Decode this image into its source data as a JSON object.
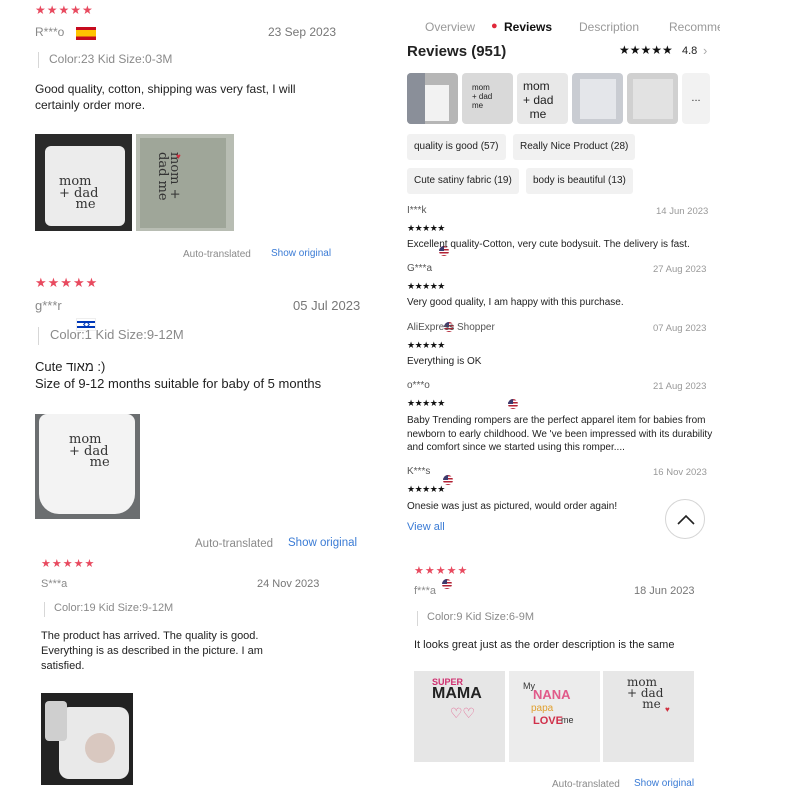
{
  "reviews_left": [
    {
      "stars": "★★★★★",
      "name": "R***o",
      "date": "23 Sep 2023",
      "variant": "Color:23 Kid Size:0-3M",
      "text": "Good quality, cotton, shipping was very fast, I will certainly order more.",
      "auto_translated": "Auto-translated",
      "show_original": "Show original"
    },
    {
      "stars": "★★★★★",
      "name": "g***r",
      "date": "05 Jul 2023",
      "variant": "Color:1 Kid Size:9-12M",
      "text_line1": "Cute מאוד :)",
      "text_line2": "Size of 9-12 months suitable for baby of 5 months",
      "auto_translated": "Auto-translated",
      "show_original": "Show original"
    },
    {
      "stars": "★★★★★",
      "name": "S***a",
      "date": "24 Nov 2023",
      "variant": "Color:19 Kid Size:9-12M",
      "text": "The product has arrived.  The quality is good.  Everything is as described in the picture.  I am satisfied."
    }
  ],
  "shirt_print": {
    "mom": "mom",
    "dad": "+ dad",
    "me": "me",
    "super": "SUPER",
    "mama": "MAMA",
    "my": "My",
    "nana": "NANA",
    "papa": "papa",
    "love": "LOVE",
    "me2": "me"
  },
  "product_panel": {
    "tabs": [
      "Overview",
      "Reviews",
      "Description",
      "Recomme"
    ],
    "active_tab": "Reviews",
    "reviews_title": "Reviews (951)",
    "rating_stars": "★★★★★",
    "rating": "4.8",
    "more_thumbs": "...",
    "chips": [
      "quality is good (57)",
      "Really Nice Product (28)",
      "Cute satiny fabric (19)",
      "body is beautiful (13)"
    ],
    "reviews": [
      {
        "name": "I***k",
        "date": "14 Jun 2023",
        "stars": "★★★★★",
        "text": "Excellent quality-Cotton, very cute bodysuit. The delivery is fast."
      },
      {
        "name": "G***a",
        "date": "27 Aug 2023",
        "stars": "★★★★★",
        "text": "Very good quality, I am happy with this purchase."
      },
      {
        "name": "AliExpress Shopper",
        "date": "07 Aug 2023",
        "stars": "★★★★★",
        "text": "Everything is OK"
      },
      {
        "name": "o***o",
        "date": "21 Aug 2023",
        "stars": "★★★★★",
        "text": "Baby Trending rompers are the perfect apparel item for babies from newborn to early childhood. We 've been impressed with its durability and comfort since we started using this romper...."
      },
      {
        "name": "K***s",
        "date": "16 Nov 2023",
        "stars": "★★★★★",
        "text": "Onesie was just as pictured, would order again!"
      }
    ],
    "view_all": "View all"
  },
  "review_right_bottom": {
    "stars": "★★★★★",
    "name": "f***a",
    "date": "18 Jun 2023",
    "variant": "Color:9 Kid Size:6-9M",
    "text": "It looks great just as the order description is the same",
    "auto_translated": "Auto-translated",
    "show_original": "Show original"
  },
  "colors": {
    "star_red": "#e84a5f",
    "link_blue": "#3a7bd5",
    "pin_red": "#e0283a"
  },
  "icons": [
    "pin-icon",
    "chevron-right-icon",
    "chevron-up-icon",
    "flag-spain-icon",
    "flag-israel-icon",
    "flag-us-icon",
    "flag-colombia-icon"
  ]
}
